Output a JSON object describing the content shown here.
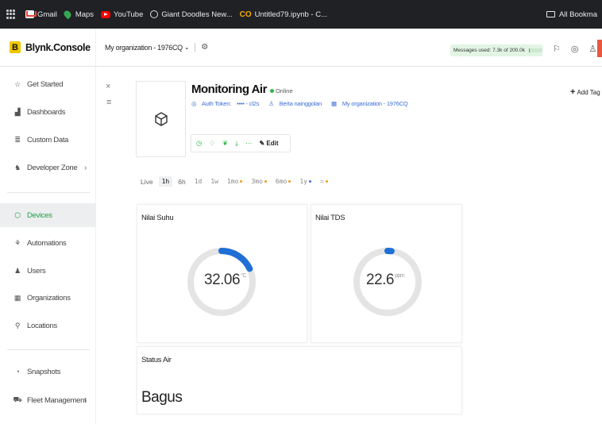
{
  "bookmarks": [
    {
      "label": "Gmail",
      "icon": "gmail-icon"
    },
    {
      "label": "Maps",
      "icon": "maps-icon"
    },
    {
      "label": "YouTube",
      "icon": "youtube-icon"
    },
    {
      "label": "Giant Doodles New...",
      "icon": "globe-icon"
    },
    {
      "label": "Untitled79.ipynb - C...",
      "icon": "colab-icon"
    }
  ],
  "all_bookmarks": "All Bookma",
  "header": {
    "brand": "Blynk.Console",
    "logo_letter": "B",
    "organization": "My organization - 1976CQ",
    "messages_used": "Messages used: 7.3k of 200.0k",
    "messages_fraction": 0.036
  },
  "sidebar": {
    "items": [
      {
        "label": "Get Started",
        "icon": "star-icon"
      },
      {
        "label": "Dashboards",
        "icon": "chart-icon"
      },
      {
        "label": "Custom Data",
        "icon": "database-icon"
      },
      {
        "label": "Developer Zone",
        "icon": "developer-icon"
      },
      {
        "label": "Devices",
        "icon": "cube-icon",
        "active": true
      },
      {
        "label": "Automations",
        "icon": "automation-icon"
      },
      {
        "label": "Users",
        "icon": "users-icon"
      },
      {
        "label": "Organizations",
        "icon": "building-icon"
      },
      {
        "label": "Locations",
        "icon": "pin-icon"
      },
      {
        "label": "Snapshots",
        "icon": "snapshot-icon"
      },
      {
        "label": "Fleet Management",
        "icon": "fleet-icon"
      }
    ]
  },
  "device": {
    "name": "Monitoring Air",
    "status": "Online",
    "auth_label": "Auth Token:",
    "auth_value": "•••• - cl2s",
    "owner": "Berta nainggolan",
    "organization": "My organization - 1976CQ",
    "edit_label": "Edit",
    "add_tag_label": "Add Tag"
  },
  "time_ranges": [
    "Live",
    "1h",
    "6h",
    "1d",
    "1w",
    "1mo",
    "3mo",
    "6mo",
    "1y"
  ],
  "selected_range": "1h",
  "widgets": {
    "suhu": {
      "title": "Nilai Suhu",
      "value": "32.06",
      "unit": "°C",
      "fraction": 0.18,
      "color": "#1f6fd6"
    },
    "tds": {
      "title": "Nilai TDS",
      "value": "22.6",
      "unit": "ppm",
      "fraction": 0.02,
      "color": "#1f6fd6"
    },
    "status": {
      "title": "Status Air",
      "value": "Bagus"
    }
  },
  "colors": {
    "accent_green": "#2eb84a",
    "gauge_track": "#e4e4e4",
    "link_blue": "#3b6fd6"
  }
}
